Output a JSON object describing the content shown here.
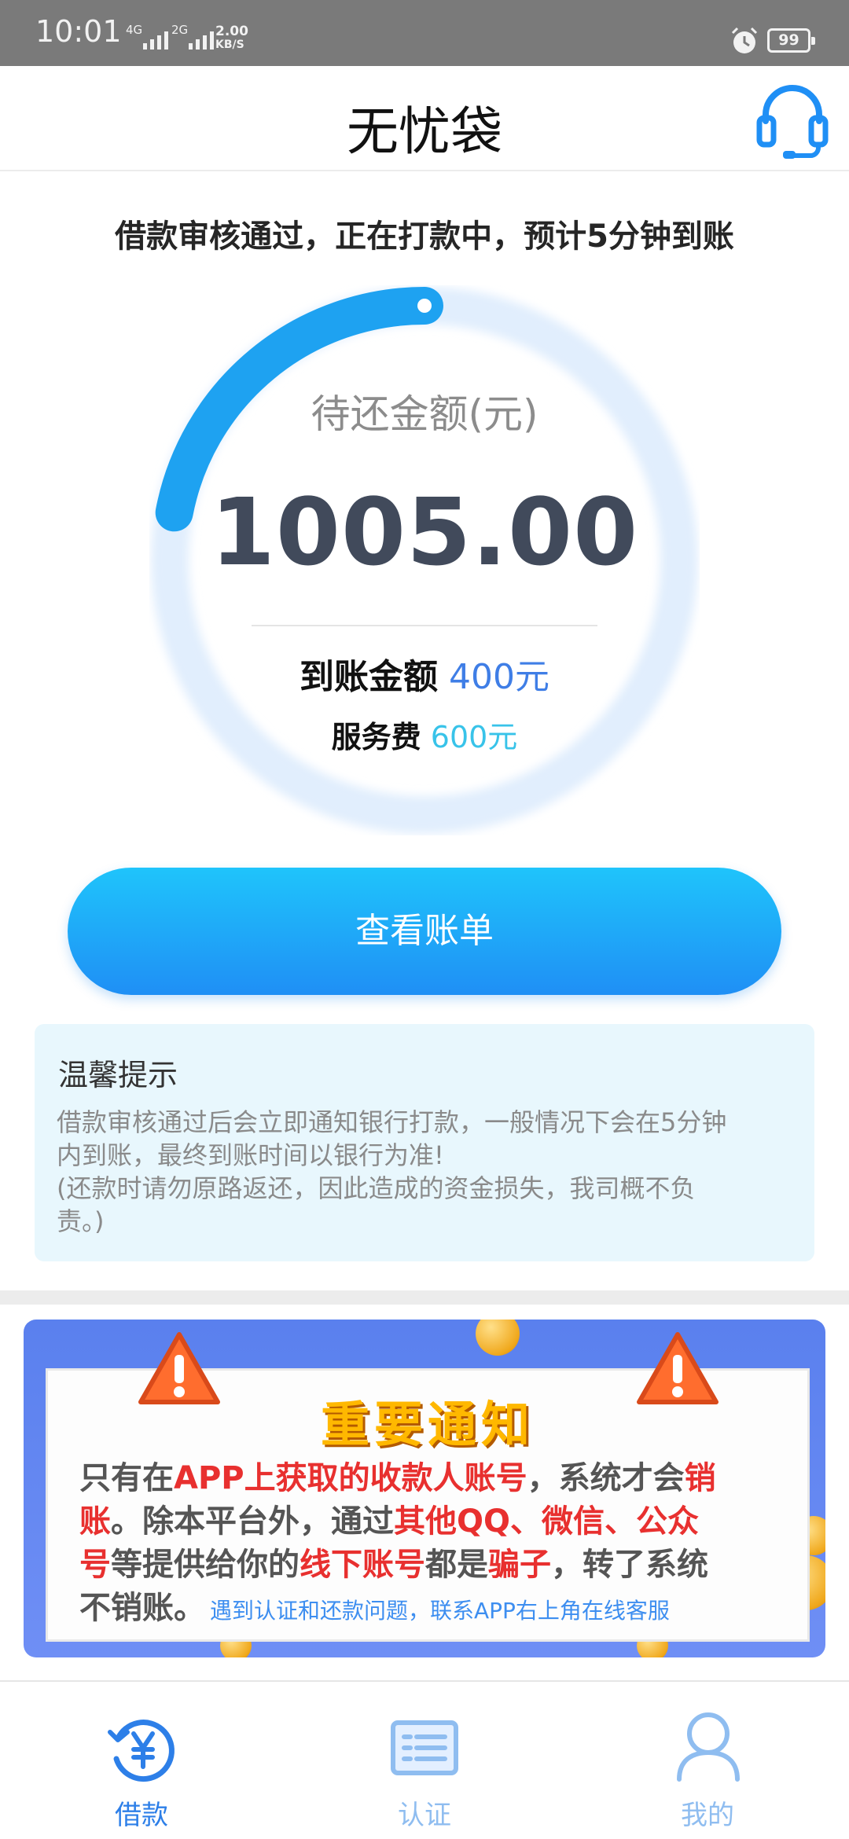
{
  "status_bar": {
    "time": "10:01",
    "network_1": "4G",
    "network_2": "2G",
    "speed_value": "2.00",
    "speed_unit": "KB/S",
    "battery": "99"
  },
  "header": {
    "title": "无忧袋",
    "support_icon": "headset-icon"
  },
  "loan_status": {
    "message": "借款审核通过，正在打款中，预计5分钟到账",
    "progress_fraction": 0.22,
    "ring_label": "待还金额(元)",
    "amount_due": "1005.00",
    "received_label": "到账金额",
    "received_value": "400元",
    "fee_label": "服务费",
    "fee_value": "600元"
  },
  "actions": {
    "view_bill_label": "查看账单"
  },
  "tips": {
    "title": "温馨提示",
    "lines": [
      "借款审核通过后会立即通知银行打款，一般情况下会在5分钟",
      "内到账，最终到账时间以银行为准!",
      "(还款时请勿原路返还，因此造成的资金损失，我司概不负",
      "责。)"
    ]
  },
  "notice": {
    "title": "重要通知",
    "line1_a": "只有在",
    "line1_b": "APP上获取的收款人账号",
    "line1_c": "，系统才会",
    "line1_d": "销",
    "line2_a": "账",
    "line2_b": "。除本平台外，通过",
    "line2_c": "其他QQ、微信、公众",
    "line3_a": "号",
    "line3_b": "等提供给你的",
    "line3_c": "线下账号",
    "line3_d": "都是",
    "line3_e": "骗子",
    "line3_f": "，转了系统",
    "line4": "不销账。",
    "hint": "遇到认证和还款问题，联系APP右上角在线客服"
  },
  "colors": {
    "accent": "#1f8ff5",
    "ring_progress": "#1ea2f1",
    "ring_track": "#e1eefd",
    "warning": "#e8302f",
    "notice_title": "#ffb800"
  },
  "bottom_nav": {
    "items": [
      {
        "label": "借款",
        "icon": "loan-yen-icon",
        "active": true
      },
      {
        "label": "认证",
        "icon": "id-card-icon",
        "active": false
      },
      {
        "label": "我的",
        "icon": "user-icon",
        "active": false
      }
    ]
  }
}
